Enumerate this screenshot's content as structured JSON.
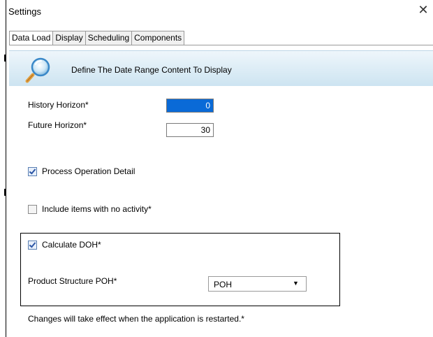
{
  "window": {
    "title": "Settings",
    "close_glyph": "✕"
  },
  "tabs": [
    {
      "label": "Data Load",
      "active": true
    },
    {
      "label": "Display",
      "active": false
    },
    {
      "label": "Scheduling",
      "active": false
    },
    {
      "label": "Components",
      "active": false
    }
  ],
  "banner": {
    "icon": "magnifier-icon",
    "text": "Define The Date Range Content To Display"
  },
  "form": {
    "history_horizon": {
      "label": "History Horizon*",
      "value": "0"
    },
    "future_horizon": {
      "label": "Future Horizon*",
      "value": "30"
    },
    "process_operation_detail": {
      "label": "Process Operation Detail",
      "checked": true
    },
    "include_no_activity": {
      "label": "Include items with no activity*",
      "checked": false
    },
    "calculate_doh": {
      "label": "Calculate DOH*",
      "checked": true
    },
    "product_structure_poh": {
      "label": "Product Structure POH*",
      "selected": "POH"
    }
  },
  "footer": {
    "note": "Changes will take effect when the application is restarted.*"
  },
  "colors": {
    "selection": "#0a6ad7",
    "banner_top": "#eef6fb",
    "banner_bottom": "#cde4f1"
  }
}
